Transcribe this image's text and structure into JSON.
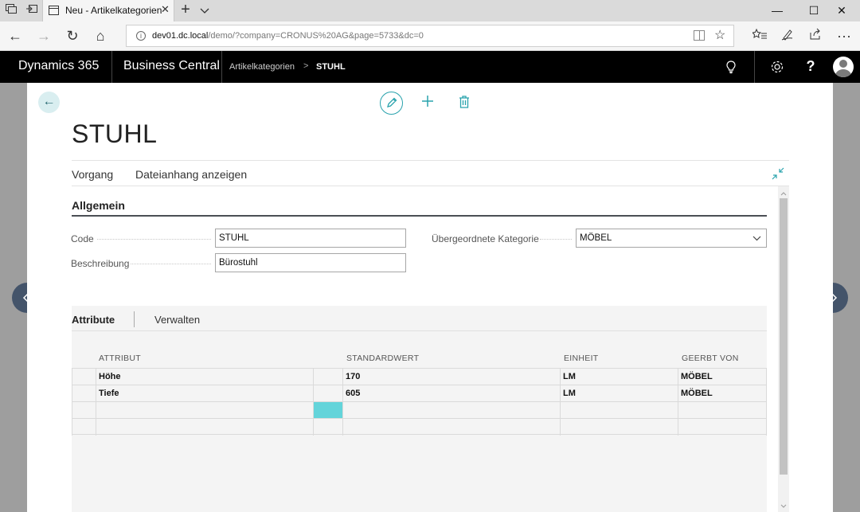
{
  "browser": {
    "tab": {
      "title": "Neu - Artikelkategorien",
      "close": "✕"
    },
    "new_tab": "+",
    "url_host": "dev01.dc.local",
    "url_path": "/demo/?company=CRONUS%20AG&page=5733&dc=0",
    "window_buttons": {
      "minimize": "—",
      "maximize": "☐",
      "close": "✕"
    },
    "nav": {
      "back": "←",
      "forward": "→",
      "refresh": "↻",
      "home": "⌂"
    },
    "toolbar_icons": [
      "tab-preview-icon",
      "set-aside-icon",
      "favorites-hub-icon",
      "pen-icon",
      "share-icon",
      "more-icon"
    ],
    "more": "···"
  },
  "bc": {
    "brand": "Dynamics 365",
    "product": "Business Central",
    "breadcrumb": [
      "Artikelkategorien",
      "STUHL"
    ],
    "breadcrumb_sep": ">",
    "help": "?",
    "icons": [
      "lightbulb-icon",
      "settings-icon",
      "help-icon",
      "avatar"
    ]
  },
  "card": {
    "back": "←",
    "title": "STUHL",
    "actions": [
      "Vorgang",
      "Dateianhang anzeigen"
    ],
    "section": "Allgemein",
    "fields": {
      "code_label": "Code",
      "code_value": "STUHL",
      "description_label": "Beschreibung",
      "description_value": "Bürostuhl",
      "parent_label": "Übergeordnete Kategorie",
      "parent_value": "MÖBEL"
    },
    "attributes": {
      "tabs": [
        "Attribute",
        "Verwalten"
      ],
      "columns": [
        "ATTRIBUT",
        "STANDARDWERT",
        "EINHEIT",
        "GEERBT VON"
      ],
      "rows": [
        {
          "attribute": "Höhe",
          "value": "170",
          "unit": "LM",
          "inherited": "MÖBEL"
        },
        {
          "attribute": "Tiefe",
          "value": "605",
          "unit": "LM",
          "inherited": "MÖBEL"
        },
        {
          "attribute": "",
          "value": "",
          "unit": "",
          "inherited": ""
        },
        {
          "attribute": "",
          "value": "",
          "unit": "",
          "inherited": ""
        }
      ]
    }
  },
  "colors": {
    "accent": "#2aa3ad",
    "header_bg": "#000000",
    "active_cell": "#63d4da",
    "page_nav": "#44546a"
  }
}
